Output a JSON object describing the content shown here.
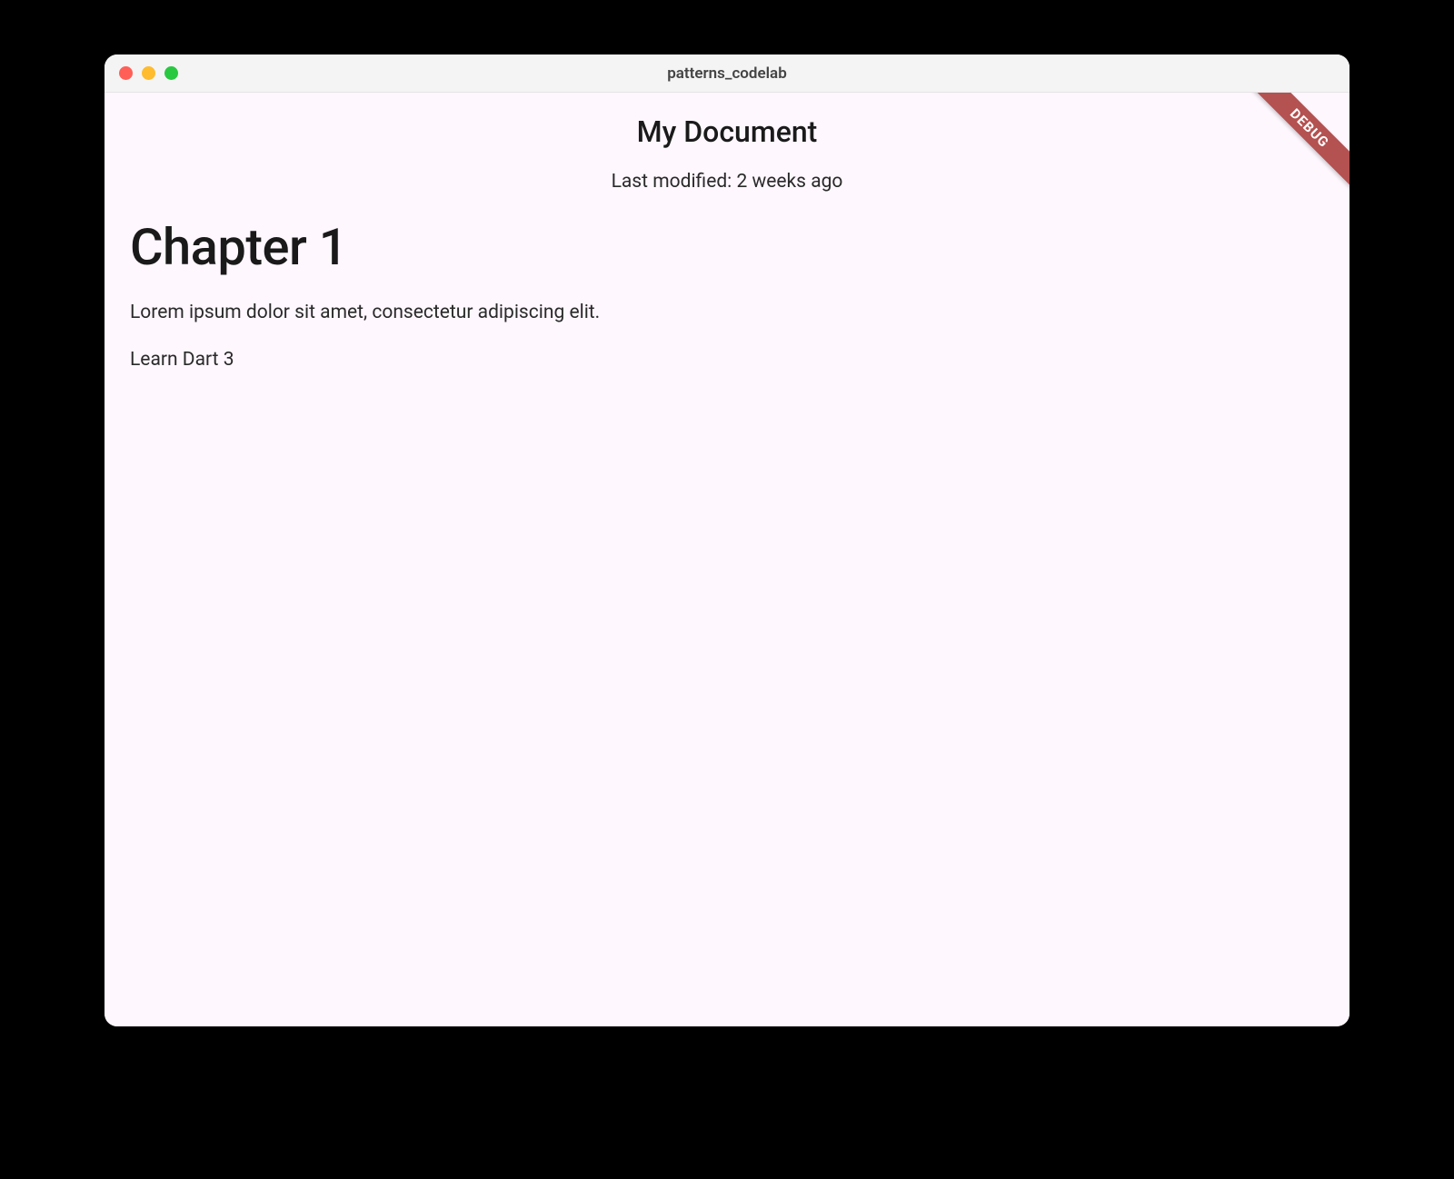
{
  "window": {
    "title": "patterns_codelab"
  },
  "debug": {
    "label": "DEBUG"
  },
  "document": {
    "title": "My Document",
    "last_modified": "Last modified: 2 weeks ago",
    "chapter_heading": "Chapter 1",
    "paragraph": "Lorem ipsum dolor sit amet, consectetur adipiscing elit.",
    "line2": "Learn Dart 3"
  }
}
